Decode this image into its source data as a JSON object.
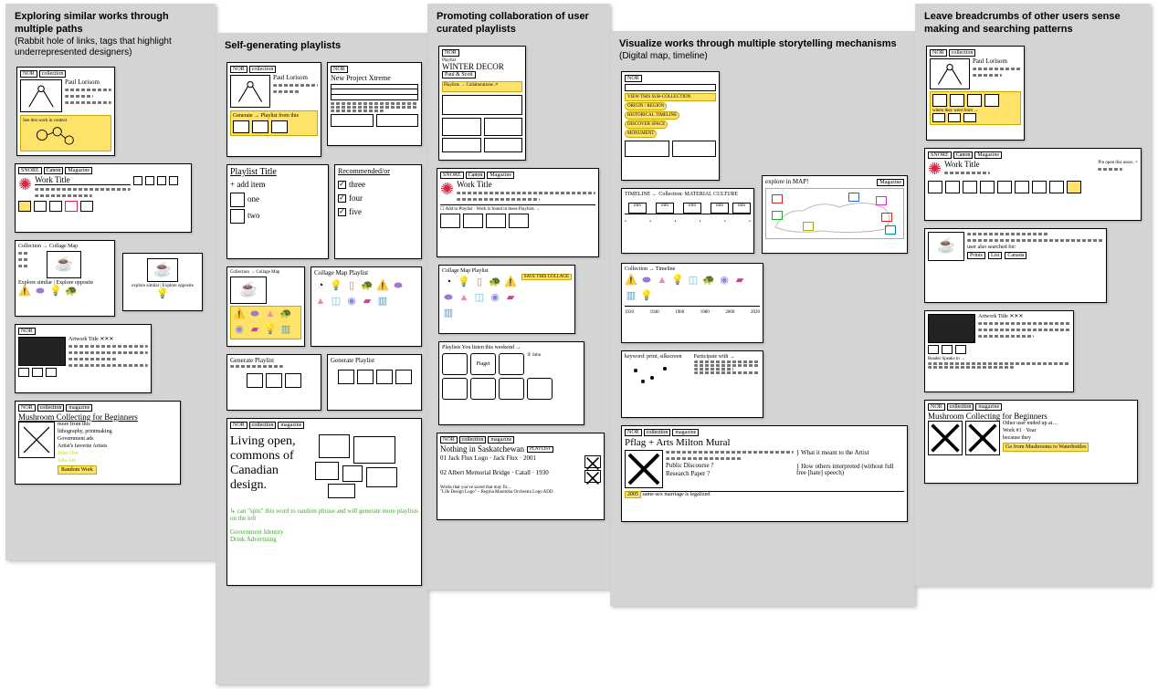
{
  "boards": {
    "exploring": {
      "title": "Exploring similar works through multiple paths",
      "subtitle": "(Rabbit hole of links, tags that highlight underrepresented designers)"
    },
    "selfgen": {
      "title": "Self-generating playlists",
      "subtitle": ""
    },
    "promoting": {
      "title": "Promoting collaboration of user curated playlists",
      "subtitle": ""
    },
    "visualize": {
      "title": "Visualize works through multiple storytelling mechanisms",
      "subtitle": "(Digital map, timeline)"
    },
    "breadcrumbs": {
      "title": "Leave breadcrumbs of other users sense making and searching patterns",
      "subtitle": ""
    }
  },
  "sketch": {
    "tabs": {
      "nor": "NOR",
      "collection": "collection",
      "magazine": "magazine"
    },
    "altTabs": {
      "canon": "Canon",
      "mag": "Magazine"
    },
    "paulLorisom": "Paul Lorisom",
    "workTitle": "Work Title",
    "playlistWinter": "WINTER DECOR",
    "playlistByline": "Paul & Scott",
    "playlistTitle": "Playlist Title",
    "addItem": "+   add  item",
    "one": "one",
    "two": "two",
    "recommended": "Recommended/or",
    "three": "three",
    "four": "four",
    "five": "five",
    "collageMap": "Collection → Collage Map",
    "collageMapPlaylist": "Collage Map Playlist",
    "exploreSimilar": "Explore similar | Explore opposite",
    "generatePlaylist": "Generate Playlist",
    "livingOpen": "Living open, commons of Canadian design.",
    "spinNote1": "can \"spin\" this word to random phrase and will generate more playlists on the left",
    "spinNote2": "Government Identity\nDrink Advertising",
    "mushrooms": "Mushroom Collecting for Beginners",
    "mushSub1": "more from this",
    "mushSub2": "lithography, printmaking",
    "mushSub3": "Government ads",
    "mushSub4": "Artist's favorite Artists",
    "mushSub5": "John Doe",
    "mushSub6": "Ada Are",
    "randomWork": "Random Work",
    "nothingSask": "Nothing in Saskatchewan",
    "playlistTag": "PLAYLIST",
    "jackFlux": "Jack Flux Logo · Jack Flux · 2001",
    "albert": "Albert Memorial Bridge · Catall · 1930",
    "saskNote": "Works that you've saved that may fit…",
    "saskAdd": "\"Life Design Logo\" – Regina Manitoba Orchestra Logo  ADD",
    "pflag": "Pflag + Arts  Milton Mural",
    "pflagNote1": "What it meant to the Artist",
    "pflagNote2": "How others interpreted (without full free [hate] speech)",
    "pflagRow1": "Public Discourse ?",
    "pflagRow2": "Research Paper ?",
    "pflagFoot": "same-sex marriage is legalized",
    "timelineHdr": "TIMELINE ← Collection: MATERIAL CULTURE",
    "exploreMap": "explore in MAP!",
    "filters": {
      "view": "VIEW THIS SUB-COLLECTION",
      "origin": "ORIGIN / REGION",
      "timeline": "HISTORICAL TIMELINE",
      "discover": "DISCOVER SPACE",
      "monument": "MONUMENT"
    },
    "crumb1": "Other user ended up at…",
    "crumb2": "Work #1 · Year",
    "crumb3": "because they",
    "crumb4": "Go from Mushrooms to Waterbottles",
    "newProject": "New Project  Xtreme",
    "generateSub": "Generate → Playlist from this",
    "playlistsListened": "Playlists  You listen this weekend →",
    "piaget": "Piaget"
  }
}
